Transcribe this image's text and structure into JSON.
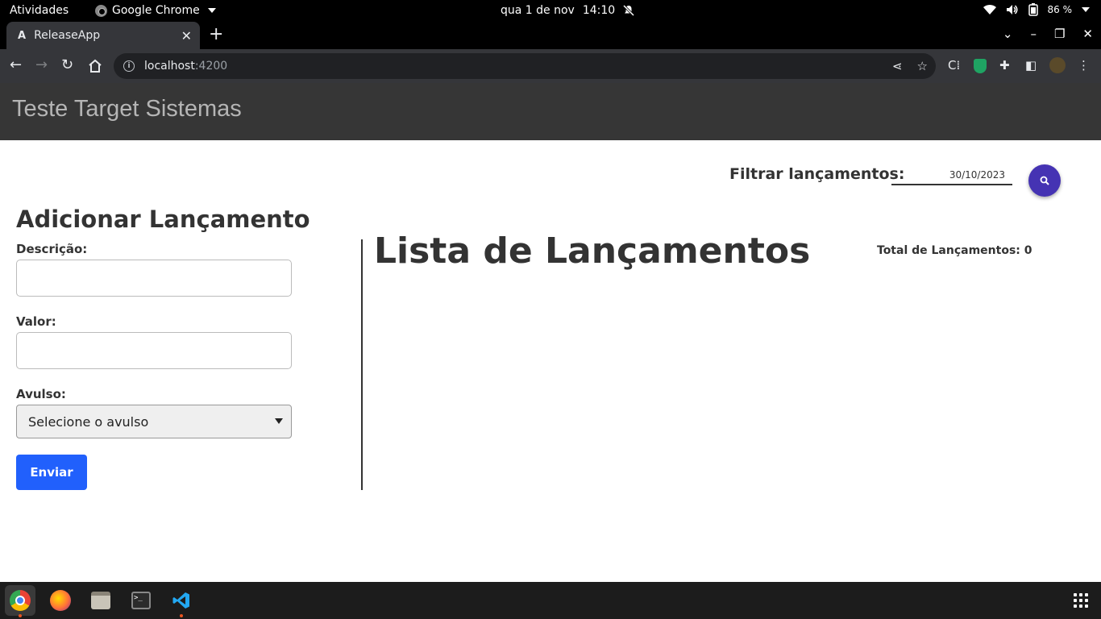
{
  "system_bar": {
    "activities": "Atividades",
    "app_name": "Google Chrome",
    "date": "qua 1 de nov",
    "time": "14:10",
    "battery": "86 %"
  },
  "browser": {
    "tab_title": "ReleaseApp",
    "tab_favicon": "A",
    "url_host": "localhost",
    "url_port": ":4200"
  },
  "app": {
    "brand": "Teste Target Sistemas",
    "filter": {
      "label": "Filtrar lançamentos:",
      "value": "30/10/2023",
      "search_icon": "search-icon"
    },
    "form": {
      "title": "Adicionar Lançamento",
      "description_label": "Descrição:",
      "description_value": "",
      "value_label": "Valor:",
      "value_value": "",
      "avulso_label": "Avulso:",
      "avulso_selected": "Selecione o avulso",
      "submit_label": "Enviar"
    },
    "list": {
      "title": "Lista de Lançamentos",
      "total_label": "Total de Lançamentos: 0"
    }
  },
  "colors": {
    "appbar_bg": "#363636",
    "search_button": "#4533b3",
    "submit_button": "#2160fc"
  },
  "dock": {
    "items": [
      "chrome-icon",
      "firefox-icon",
      "files-icon",
      "terminal-icon",
      "vscode-icon"
    ]
  }
}
